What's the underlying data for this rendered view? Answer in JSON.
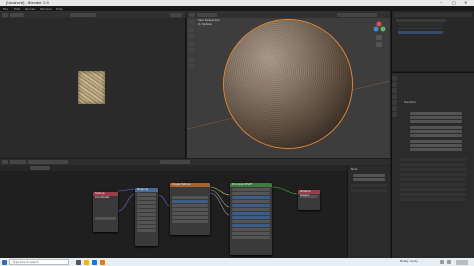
{
  "window": {
    "title": "[Unsaved] - Blender 2.9",
    "controls": [
      "–",
      "□",
      "✕"
    ]
  },
  "menubar": {
    "items": [
      "File",
      "Edit",
      "Render",
      "Window",
      "Help"
    ]
  },
  "viewport": {
    "header_label": "User Perspective",
    "object_label": "(1) Sphere"
  },
  "node_editor": {
    "nodes": [
      {
        "title": "Texture Coordinate",
        "color": "#9b3c4a"
      },
      {
        "title": "Mapping",
        "color": "#4a6a9b"
      },
      {
        "title": "Image Texture",
        "color": "#a5642e"
      },
      {
        "title": "Principled BSDF",
        "color": "#3f7a3f"
      },
      {
        "title": "Material Output",
        "color": "#9b3c4a"
      }
    ],
    "sidebar_header": "Node"
  },
  "properties": {
    "section_header": "Transform"
  },
  "taskbar": {
    "search_placeholder": "Type here to search",
    "weather": "Mostly cloudy"
  },
  "colors": {
    "accent_orange": "#e08a33",
    "node_link": "#c7c76a",
    "taskbar": "#e7eef4"
  }
}
